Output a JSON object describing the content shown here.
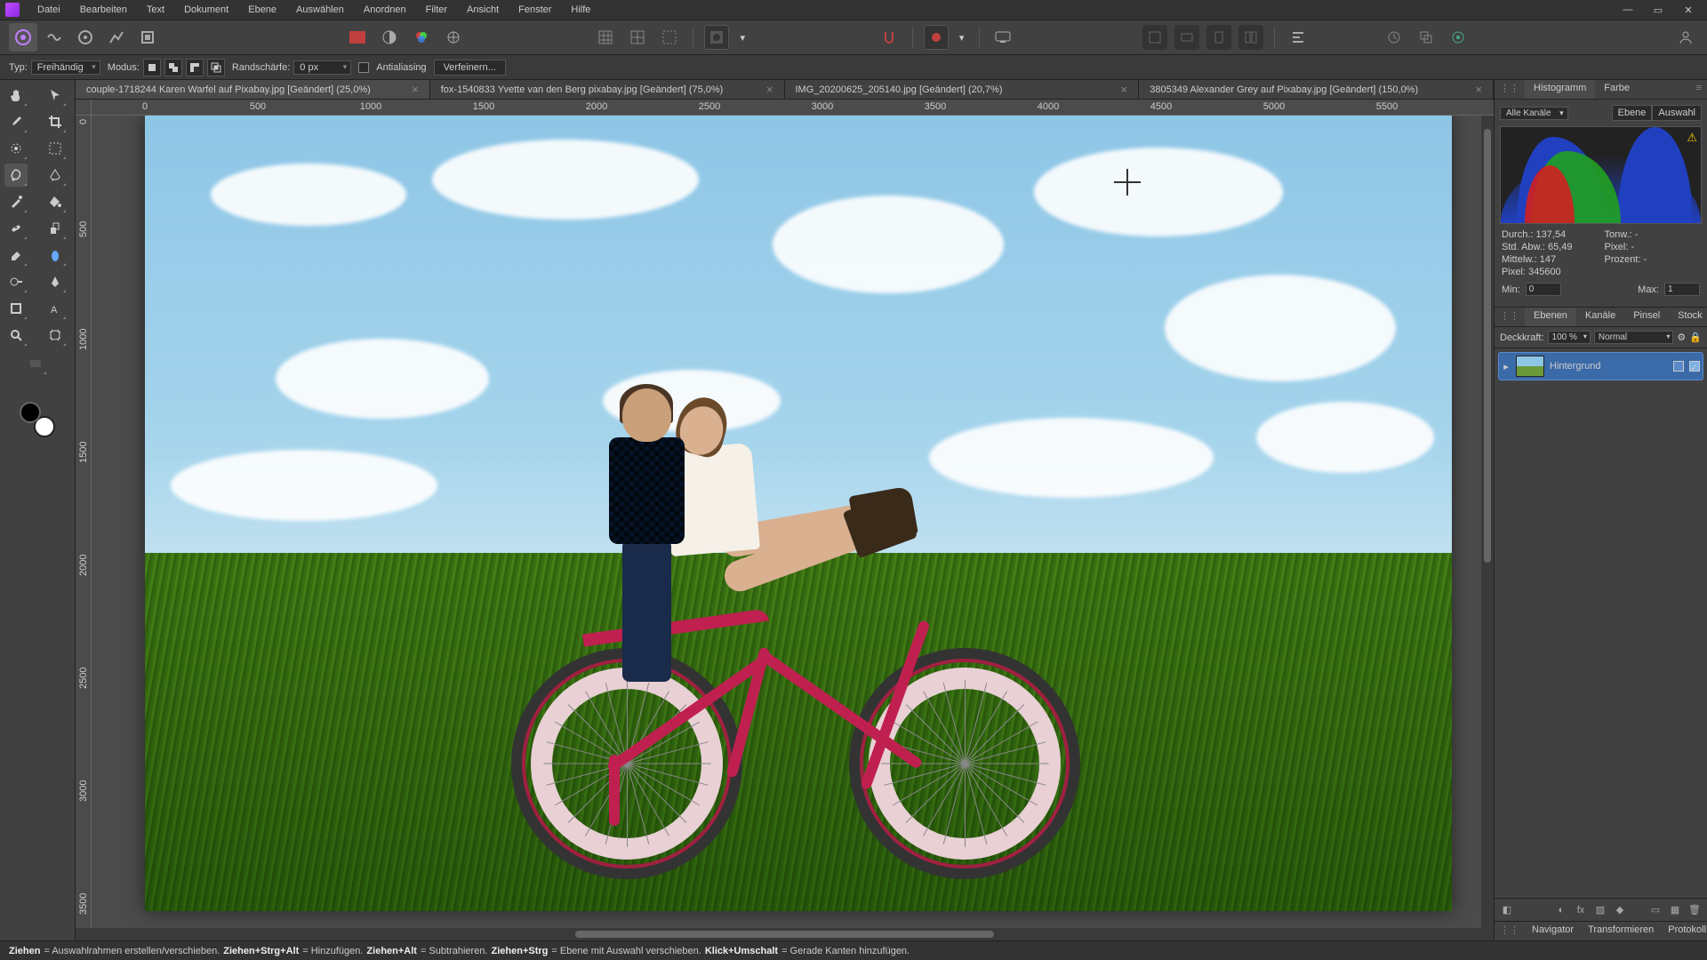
{
  "menu": [
    "Datei",
    "Bearbeiten",
    "Text",
    "Dokument",
    "Ebene",
    "Auswählen",
    "Anordnen",
    "Filter",
    "Ansicht",
    "Fenster",
    "Hilfe"
  ],
  "contextbar": {
    "type_label": "Typ:",
    "type_value": "Freihändig",
    "mode_label": "Modus:",
    "feather_label": "Randschärfe:",
    "feather_value": "0 px",
    "antialias": "Antialiasing",
    "refine": "Verfeinern..."
  },
  "tabs": [
    {
      "title": "couple-1718244 Karen Warfel auf Pixabay.jpg [Geändert] (25,0%)",
      "active": true
    },
    {
      "title": "fox-1540833 Yvette van den Berg pixabay.jpg [Geändert] (75,0%)",
      "active": false
    },
    {
      "title": "IMG_20200625_205140.jpg [Geändert] (20,7%)",
      "active": false
    },
    {
      "title": "3805349 Alexander Grey auf Pixabay.jpg [Geändert] (150,0%)",
      "active": false
    }
  ],
  "ruler_h": [
    "0",
    "500",
    "1000",
    "1500",
    "2000",
    "2500",
    "3000",
    "3500",
    "4000",
    "4500",
    "5000",
    "5500"
  ],
  "ruler_v": [
    "0",
    "500",
    "1000",
    "1500",
    "2000",
    "2500",
    "3000",
    "3500"
  ],
  "status": {
    "t1": "Ziehen",
    "d1": " = Auswahlrahmen erstellen/verschieben. ",
    "t2": "Ziehen+Strg+Alt",
    "d2": " = Hinzufügen. ",
    "t3": "Ziehen+Alt",
    "d3": " = Subtrahieren. ",
    "t4": "Ziehen+Strg",
    "d4": " = Ebene mit Auswahl verschieben. ",
    "t5": "Klick+Umschalt",
    "d5": " = Gerade Kanten hinzufügen."
  },
  "panels": {
    "top_tabs": [
      "Histogramm",
      "Farbe"
    ],
    "channel": "Alle Kanäle",
    "mini_tabs": [
      "Ebene",
      "Auswahl"
    ],
    "stats": {
      "durch_l": "Durch.:",
      "durch_v": "137,54",
      "std_l": "Std. Abw.:",
      "std_v": "65,49",
      "mittel_l": "Mittelw.:",
      "mittel_v": "147",
      "pixel_l": "Pixel:",
      "pixel_v": "345600",
      "tonw_l": "Tonw.:",
      "tonw_v": "-",
      "pix2_l": "Pixel:",
      "pix2_v": "-",
      "proz_l": "Prozent:",
      "proz_v": "-"
    },
    "min_l": "Min:",
    "min_v": "0",
    "max_l": "Max:",
    "max_v": "1",
    "layer_tabs": [
      "Ebenen",
      "Kanäle",
      "Pinsel",
      "Stock"
    ],
    "opacity_l": "Deckkraft:",
    "opacity_v": "100 %",
    "blend": "Normal",
    "layer_name": "Hintergrund",
    "bottom_tabs": [
      "Navigator",
      "Transformieren",
      "Protokoll"
    ]
  }
}
